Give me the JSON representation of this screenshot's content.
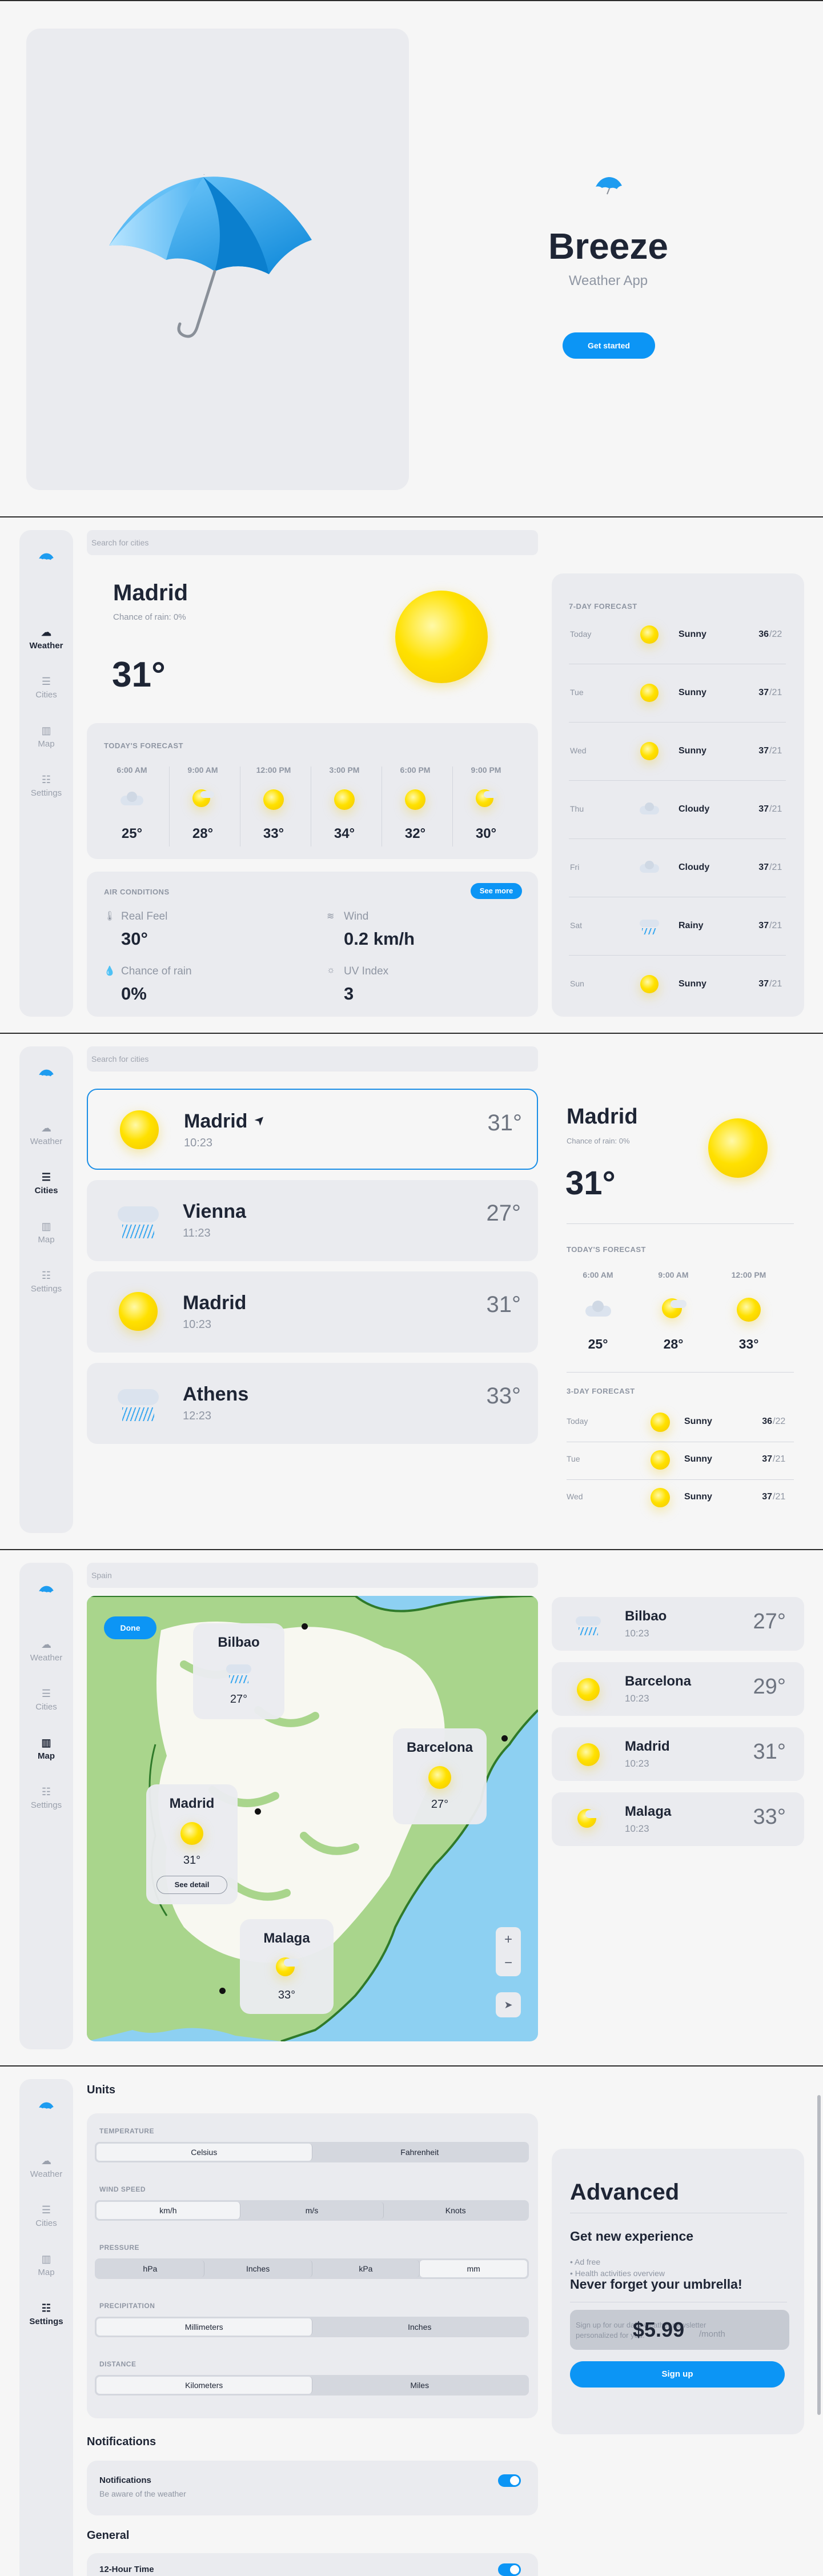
{
  "onboarding": {
    "app_name": "Breeze",
    "subtitle": "Weather App",
    "cta": "Get started"
  },
  "nav": {
    "weather": "Weather",
    "cities": "Cities",
    "map": "Map",
    "settings": "Settings"
  },
  "search": {
    "placeholder": "Search for cities",
    "map_value": "Spain"
  },
  "weather": {
    "city": "Madrid",
    "rain": "Chance of rain: 0%",
    "temp": "31°",
    "today_label": "TODAY'S FORECAST",
    "hours": [
      {
        "time": "6:00 AM",
        "icon": "cloudy-icon",
        "temp": "25°"
      },
      {
        "time": "9:00 AM",
        "icon": "partly-cloudy-icon",
        "temp": "28°"
      },
      {
        "time": "12:00 PM",
        "icon": "sun-icon",
        "temp": "33°"
      },
      {
        "time": "3:00 PM",
        "icon": "sun-icon",
        "temp": "34°"
      },
      {
        "time": "6:00 PM",
        "icon": "sun-icon",
        "temp": "32°"
      },
      {
        "time": "9:00 PM",
        "icon": "partly-cloudy-icon",
        "temp": "30°"
      }
    ],
    "air_label": "AIR CONDITIONS",
    "see_more": "See more",
    "air": [
      {
        "icon": "thermometer-icon",
        "label": "Real Feel",
        "value": "30°"
      },
      {
        "icon": "wind-icon",
        "label": "Wind",
        "value": "0.2 km/h"
      },
      {
        "icon": "drop-icon",
        "label": "Chance of rain",
        "value": "0%"
      },
      {
        "icon": "sun-small-icon",
        "label": "UV Index",
        "value": "3"
      }
    ],
    "week_label": "7-DAY FORECAST",
    "week": [
      {
        "day": "Today",
        "icon": "sun-icon",
        "cond": "Sunny",
        "hi": "36",
        "lo": "/22"
      },
      {
        "day": "Tue",
        "icon": "sun-icon",
        "cond": "Sunny",
        "hi": "37",
        "lo": "/21"
      },
      {
        "day": "Wed",
        "icon": "sun-icon",
        "cond": "Sunny",
        "hi": "37",
        "lo": "/21"
      },
      {
        "day": "Thu",
        "icon": "cloudy-icon",
        "cond": "Cloudy",
        "hi": "37",
        "lo": "/21"
      },
      {
        "day": "Fri",
        "icon": "cloudy-icon",
        "cond": "Cloudy",
        "hi": "37",
        "lo": "/21"
      },
      {
        "day": "Sat",
        "icon": "rain-icon",
        "cond": "Rainy",
        "hi": "37",
        "lo": "/21"
      },
      {
        "day": "Sun",
        "icon": "sun-icon",
        "cond": "Sunny",
        "hi": "37",
        "lo": "/21"
      }
    ]
  },
  "cities": {
    "list": [
      {
        "name": "Madrid",
        "time": "10:23",
        "temp": "31°",
        "icon": "sun-icon"
      },
      {
        "name": "Vienna",
        "time": "11:23",
        "temp": "27°",
        "icon": "rain-icon"
      },
      {
        "name": "Madrid",
        "time": "10:23",
        "temp": "31°",
        "icon": "sun-icon"
      },
      {
        "name": "Athens",
        "time": "12:23",
        "temp": "33°",
        "icon": "rain-icon"
      }
    ],
    "detail": {
      "city": "Madrid",
      "rain": "Chance of rain: 0%",
      "temp": "31°",
      "today_label": "TODAY'S FORECAST",
      "hours": [
        {
          "time": "6:00 AM",
          "temp": "25°"
        },
        {
          "time": "9:00 AM",
          "temp": "28°"
        },
        {
          "time": "12:00 PM",
          "temp": "33°"
        }
      ],
      "days_label": "3-DAY FORECAST",
      "days": [
        {
          "day": "Today",
          "cond": "Sunny",
          "hi": "36",
          "lo": "/22"
        },
        {
          "day": "Tue",
          "cond": "Sunny",
          "hi": "37",
          "lo": "/21"
        },
        {
          "day": "Wed",
          "cond": "Sunny",
          "hi": "37",
          "lo": "/21"
        }
      ]
    }
  },
  "map": {
    "done": "Done",
    "cards": [
      {
        "name": "Bilbao",
        "temp": "27°"
      },
      {
        "name": "Barcelona",
        "temp": "27°"
      },
      {
        "name": "Madrid",
        "temp": "31°",
        "detail": "See detail"
      },
      {
        "name": "Malaga",
        "temp": "33°"
      }
    ],
    "zoom_in": "+",
    "zoom_out": "−",
    "list": [
      {
        "name": "Bilbao",
        "time": "10:23",
        "temp": "27°",
        "icon": "rain-icon"
      },
      {
        "name": "Barcelona",
        "time": "10:23",
        "temp": "29°",
        "icon": "sun-icon"
      },
      {
        "name": "Madrid",
        "time": "10:23",
        "temp": "31°",
        "icon": "sun-icon"
      },
      {
        "name": "Malaga",
        "time": "10:23",
        "temp": "33°",
        "icon": "partly-cloudy-icon"
      }
    ]
  },
  "settings": {
    "units_title": "Units",
    "groups": [
      {
        "label": "TEMPERATURE",
        "options": [
          "Celsius",
          "Fahrenheit"
        ],
        "selected": 0
      },
      {
        "label": "WIND SPEED",
        "options": [
          "km/h",
          "m/s",
          "Knots"
        ],
        "selected": 0
      },
      {
        "label": "PRESSURE",
        "options": [
          "hPa",
          "Inches",
          "kPa",
          "mm"
        ],
        "selected": 3
      },
      {
        "label": "PRECIPITATION",
        "options": [
          "Millimeters",
          "Inches"
        ],
        "selected": 0
      },
      {
        "label": "DISTANCE",
        "options": [
          "Kilometers",
          "Miles"
        ],
        "selected": 0
      }
    ],
    "notifications_title": "Notifications",
    "notif_label": "Notifications",
    "notif_sub": "Be aware of the weather",
    "general_title": "General",
    "general_row": "12-Hour Time",
    "advanced": {
      "title": "Advanced",
      "subtitle": "Get new experience",
      "bullets": [
        "• Ad free",
        "• Health activities overview"
      ],
      "banner": "Never forget your umbrella!",
      "promo": "Sign up for our daily weather newsletter personalized for you.",
      "price": "$5.99",
      "per": "/month",
      "signup": "Sign up"
    }
  },
  "colors": {
    "accent": "#0c95f5",
    "panel": "#eaebef",
    "text": "#1e2535",
    "muted": "#8f96a3"
  }
}
